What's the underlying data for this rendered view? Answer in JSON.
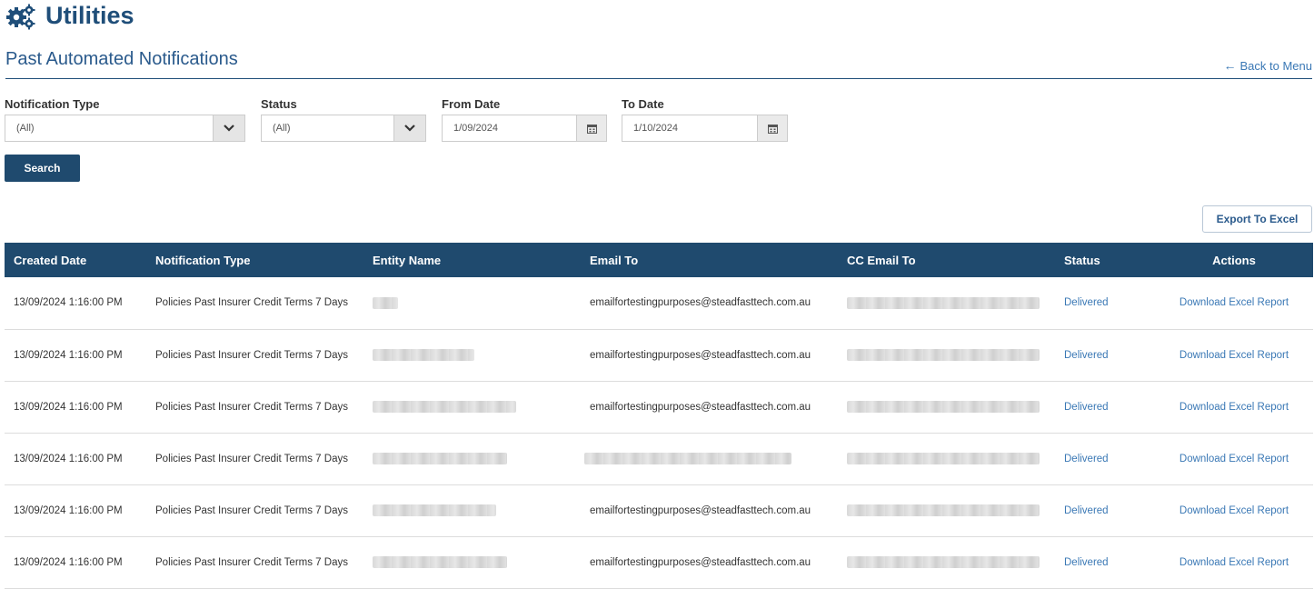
{
  "header": {
    "title": "Utilities",
    "icon": "gears-icon"
  },
  "section": {
    "title": "Past Automated Notifications",
    "back_link": "Back to Menu"
  },
  "filters": {
    "notification_type": {
      "label": "Notification Type",
      "value": "(All)"
    },
    "status": {
      "label": "Status",
      "value": "(All)"
    },
    "from_date": {
      "label": "From Date",
      "value": "1/09/2024"
    },
    "to_date": {
      "label": "To Date",
      "value": "1/10/2024"
    }
  },
  "buttons": {
    "search": "Search",
    "export": "Export To Excel"
  },
  "table": {
    "headers": [
      "Created Date",
      "Notification Type",
      "Entity Name",
      "Email To",
      "CC Email To",
      "Status",
      "Actions"
    ],
    "rows": [
      {
        "created": "13/09/2024 1:16:00 PM",
        "type": "Policies Past Insurer Credit Terms 7 Days",
        "email": "emailfortestingpurposes@steadfasttech.com.au",
        "status": "Delivered",
        "action": "Download Excel Report"
      },
      {
        "created": "13/09/2024 1:16:00 PM",
        "type": "Policies Past Insurer Credit Terms 7 Days",
        "email": "emailfortestingpurposes@steadfasttech.com.au",
        "status": "Delivered",
        "action": "Download Excel Report"
      },
      {
        "created": "13/09/2024 1:16:00 PM",
        "type": "Policies Past Insurer Credit Terms 7 Days",
        "email": "emailfortestingpurposes@steadfasttech.com.au",
        "status": "Delivered",
        "action": "Download Excel Report"
      },
      {
        "created": "13/09/2024 1:16:00 PM",
        "type": "Policies Past Insurer Credit Terms 7 Days",
        "email": "",
        "status": "Delivered",
        "action": "Download Excel Report"
      },
      {
        "created": "13/09/2024 1:16:00 PM",
        "type": "Policies Past Insurer Credit Terms 7 Days",
        "email": "emailfortestingpurposes@steadfasttech.com.au",
        "status": "Delivered",
        "action": "Download Excel Report"
      },
      {
        "created": "13/09/2024 1:16:00 PM",
        "type": "Policies Past Insurer Credit Terms 7 Days",
        "email": "emailfortestingpurposes@steadfasttech.com.au",
        "status": "Delivered",
        "action": "Download Excel Report"
      }
    ]
  },
  "colors": {
    "primary": "#1f4a6e",
    "title": "#1f4e79",
    "link": "#3a78b5"
  }
}
